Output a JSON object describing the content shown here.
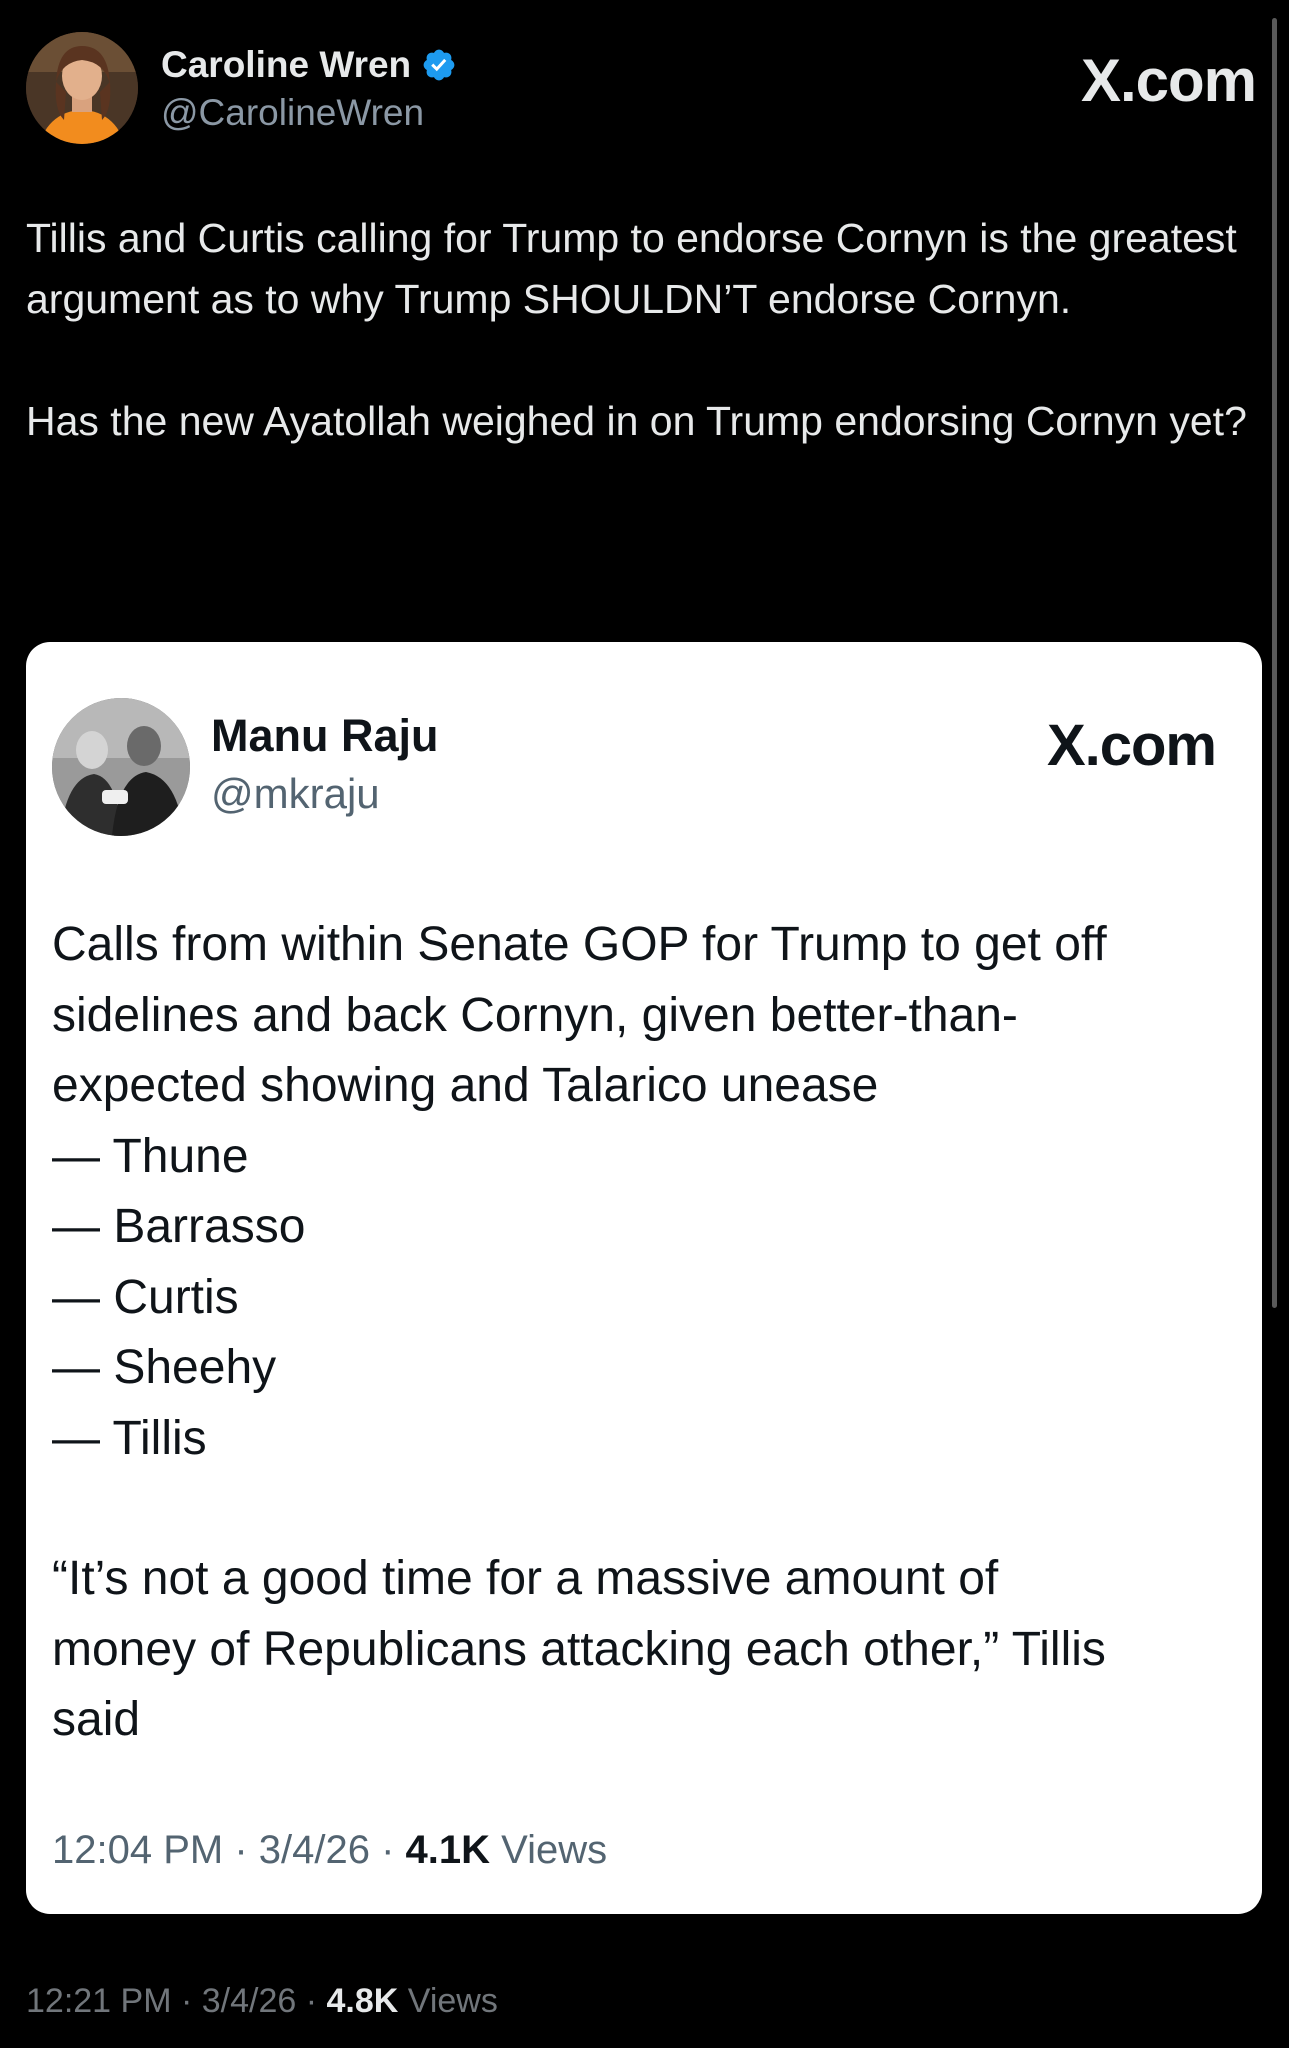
{
  "outer_tweet": {
    "display_name": "Caroline Wren",
    "handle": "@CarolineWren",
    "source_logo": "X.com",
    "verified_icon": "verified-badge-icon",
    "text": "Tillis and Curtis calling for Trump to endorse Cornyn is the greatest argument as to why Trump SHOULDN’T endorse Cornyn.\n\nHas the new Ayatollah weighed in on Trump endorsing Cornyn yet?",
    "time": "12:21 PM",
    "date": "3/4/26",
    "views_count": "4.8K",
    "views_label": "Views"
  },
  "quoted_tweet": {
    "display_name": "Manu Raju",
    "handle": "@mkraju",
    "source_logo": "X.com",
    "lines": [
      "Calls from within Senate GOP for Trump to get off",
      "sidelines and back Cornyn, given better-than-",
      "expected showing and Talarico unease",
      "— Thune",
      "— Barrasso",
      "— Curtis",
      "— Sheehy",
      "— Tillis"
    ],
    "quote_lines": [
      "“It’s not a good time for a massive amount of",
      "money of Republicans attacking each other,” Tillis",
      "said"
    ],
    "time": "12:04 PM",
    "date": "3/4/26",
    "views_count": "4.1K",
    "views_label": "Views"
  },
  "colors": {
    "background": "#000000",
    "card_background": "#ffffff",
    "verified_blue": "#1d9bf0",
    "muted_text_dark": "#8b98a5",
    "muted_text_light": "#536471"
  }
}
